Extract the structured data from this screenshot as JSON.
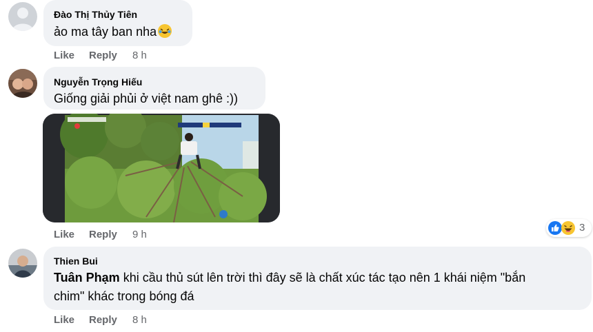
{
  "comments": [
    {
      "author": "Đào Thị Thủy Tiên",
      "text": "ảo ma tây ban nha",
      "emoji": "rolling-on-floor-laughing-emoji",
      "like": "Like",
      "reply": "Reply",
      "time": "8 h"
    },
    {
      "author": "Nguyễn Trọng Hiếu",
      "text": "Giống giải phủi ở việt nam ghê :))",
      "like": "Like",
      "reply": "Reply",
      "time": "9 h",
      "reactions": {
        "count": "3",
        "icons": [
          "like-reaction-icon",
          "haha-reaction-icon"
        ]
      }
    },
    {
      "author": "Thien Bui",
      "mention": "Tuân Phạm",
      "text_line1": " khi cầu thủ sút lên trời thì đây sẽ là chất xúc tác tạo nên 1 khái niệm \"bắn",
      "text_line2": "chim\" khác trong bóng đá",
      "like": "Like",
      "reply": "Reply",
      "time": "8 h"
    }
  ],
  "colors": {
    "bubble": "#f0f2f5",
    "secondary_text": "#65676b",
    "like_blue": "#1877f2",
    "haha_yellow": "#f7c531"
  }
}
